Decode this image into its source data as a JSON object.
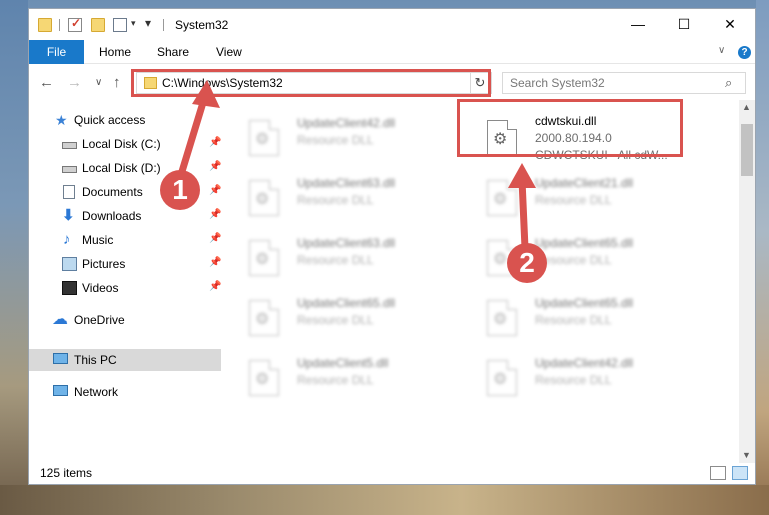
{
  "window": {
    "title": "System32"
  },
  "ribbon": {
    "tabs": [
      "File",
      "Home",
      "Share",
      "View"
    ],
    "help_label": "?"
  },
  "nav": {
    "address_path": "C:\\Windows\\System32",
    "search_placeholder": "Search System32"
  },
  "sidebar": {
    "items": [
      {
        "label": "Quick access",
        "icon": "star-icon",
        "pinned": false
      },
      {
        "label": "Local Disk (C:)",
        "icon": "drive-icon",
        "pinned": true
      },
      {
        "label": "Local Disk (D:)",
        "icon": "drive-icon",
        "pinned": true
      },
      {
        "label": "Documents",
        "icon": "documents-icon",
        "pinned": true
      },
      {
        "label": "Downloads",
        "icon": "download-icon",
        "pinned": true
      },
      {
        "label": "Music",
        "icon": "music-icon",
        "pinned": true
      },
      {
        "label": "Pictures",
        "icon": "pictures-icon",
        "pinned": true
      },
      {
        "label": "Videos",
        "icon": "videos-icon",
        "pinned": true
      },
      {
        "label": "OneDrive",
        "icon": "onedrive-icon",
        "pinned": false
      },
      {
        "label": "This PC",
        "icon": "computer-icon",
        "pinned": false
      },
      {
        "label": "Network",
        "icon": "network-icon",
        "pinned": false
      }
    ]
  },
  "files": [
    {
      "name": "UpdateClient42.dll",
      "type": "Resource DLL"
    },
    {
      "name": "UpdateClient63.dll",
      "type": "Resource DLL"
    },
    {
      "name": "UpdateClient63.dll",
      "type": "Resource DLL"
    },
    {
      "name": "UpdateClient65.dll",
      "type": "Resource DLL"
    },
    {
      "name": "UpdateClient5.dll",
      "type": "Resource DLL"
    },
    {
      "name": "UpdateClient21.dll",
      "type": "Resource DLL"
    },
    {
      "name": "UpdateClient65.dll",
      "type": "Resource DLL"
    },
    {
      "name": "UpdateClient65.dll",
      "type": "Resource DLL"
    },
    {
      "name": "UpdateClient42.dll",
      "type": "Resource DLL"
    }
  ],
  "highlighted_file": {
    "name": "cdwtskui.dll",
    "version": "2000.80.194.0",
    "description": "CDWCTSKUI - All cdW..."
  },
  "status": {
    "item_count": "125 items"
  },
  "annotations": {
    "step1": "1",
    "step2": "2",
    "color": "#d9534f"
  }
}
